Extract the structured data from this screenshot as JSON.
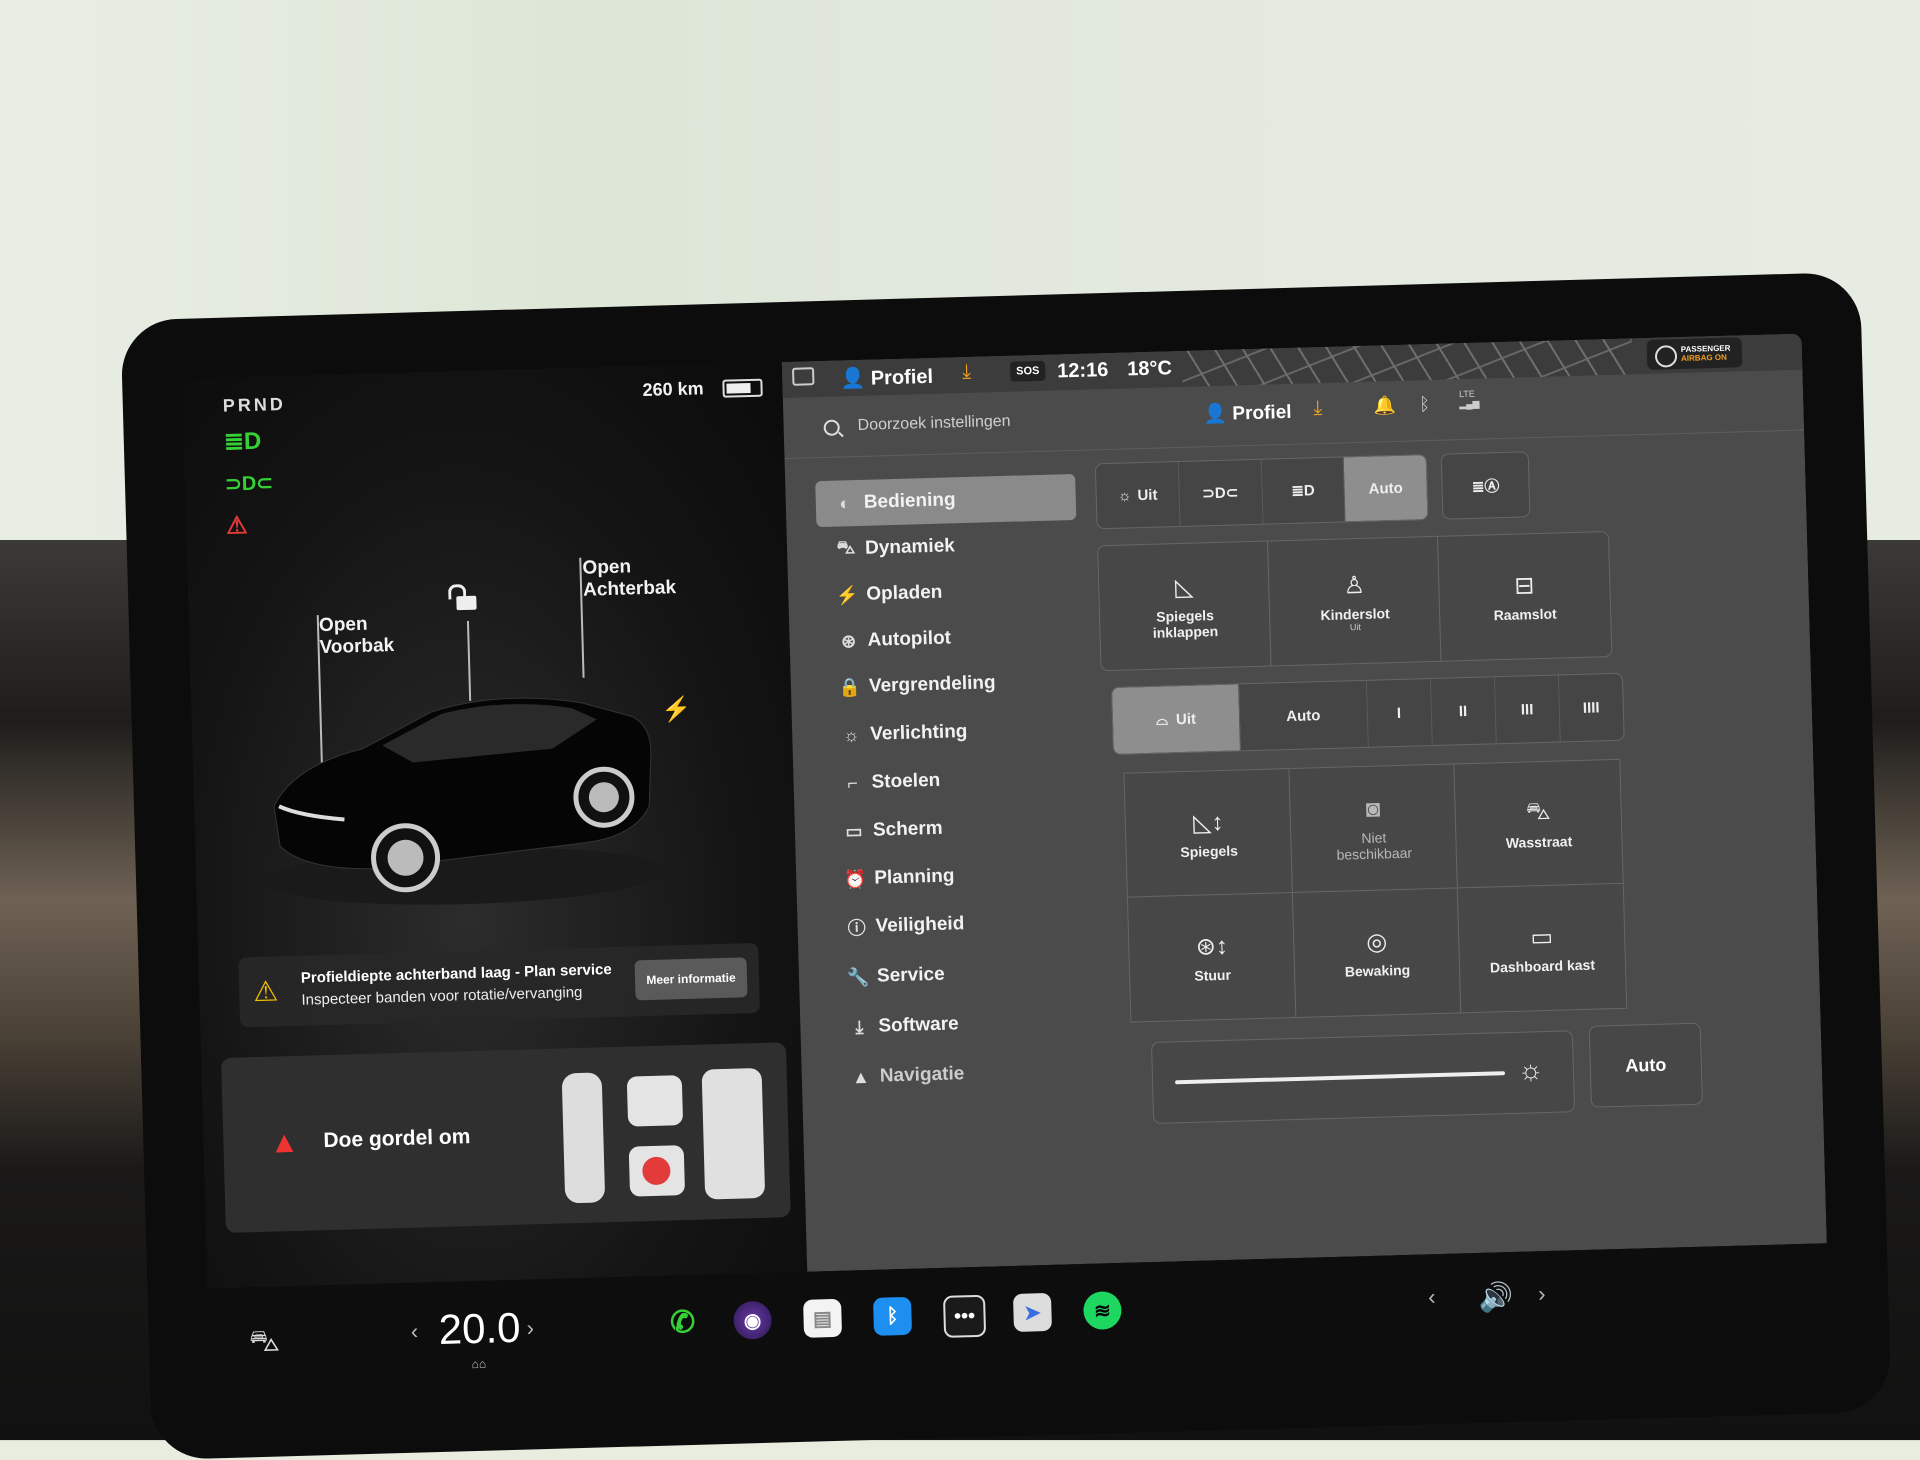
{
  "vehicle": {
    "gear": "PRND",
    "range": "260 km",
    "label_front": "Open\nVoorbak",
    "label_front_l1": "Open",
    "label_front_l2": "Voorbak",
    "label_trunk_l1": "Open",
    "label_trunk_l2": "Achterbak",
    "alert_title": "Profieldiepte achterband laag - Plan service",
    "alert_sub": "Inspecteer banden voor rotatie/vervanging",
    "alert_button": "Meer informatie",
    "belt_text": "Doe gordel om"
  },
  "status_bar": {
    "profile": "Profiel",
    "sos": "SOS",
    "time": "12:16",
    "temperature": "18°C",
    "airbag_l1": "PASSENGER",
    "airbag_l2": "AIRBAG ON"
  },
  "settings_header": {
    "search_placeholder": "Doorzoek instellingen",
    "profile": "Profiel",
    "lte": "LTE"
  },
  "menu": [
    {
      "label": "Bediening",
      "icon": "toggle-icon"
    },
    {
      "label": "Dynamiek",
      "icon": "car-icon"
    },
    {
      "label": "Opladen",
      "icon": "bolt-icon"
    },
    {
      "label": "Autopilot",
      "icon": "steering-wheel-icon"
    },
    {
      "label": "Vergrendeling",
      "icon": "lock-icon"
    },
    {
      "label": "Verlichting",
      "icon": "sun-icon"
    },
    {
      "label": "Stoelen",
      "icon": "seat-icon"
    },
    {
      "label": "Scherm",
      "icon": "display-icon"
    },
    {
      "label": "Planning",
      "icon": "alarm-icon"
    },
    {
      "label": "Veiligheid",
      "icon": "info-icon"
    },
    {
      "label": "Service",
      "icon": "wrench-icon"
    },
    {
      "label": "Software",
      "icon": "download-icon"
    },
    {
      "label": "Navigatie",
      "icon": "navigation-icon"
    }
  ],
  "controls": {
    "lights": {
      "off": "Uit",
      "auto": "Auto"
    },
    "tiles_row1": [
      {
        "l1": "Spiegels",
        "l2": "inklappen"
      },
      {
        "l1": "Kinderslot",
        "sub": "Uit"
      },
      {
        "l1": "Raamslot"
      }
    ],
    "wipers": [
      "Uit",
      "Auto",
      "I",
      "II",
      "III",
      "IIII"
    ],
    "tiles_grid": [
      {
        "label": "Spiegels"
      },
      {
        "l1": "Niet",
        "l2": "beschikbaar"
      },
      {
        "label": "Wasstraat"
      },
      {
        "label": "Stuur"
      },
      {
        "label": "Bewaking"
      },
      {
        "label": "Dashboard kast"
      }
    ],
    "brightness_auto": "Auto"
  },
  "bottom_bar": {
    "temperature": "20.0"
  },
  "colors": {
    "accent_green": "#35d235",
    "alert_red": "#e33a3a",
    "warning_yellow": "#f0c000",
    "download_orange": "#f0a020"
  }
}
